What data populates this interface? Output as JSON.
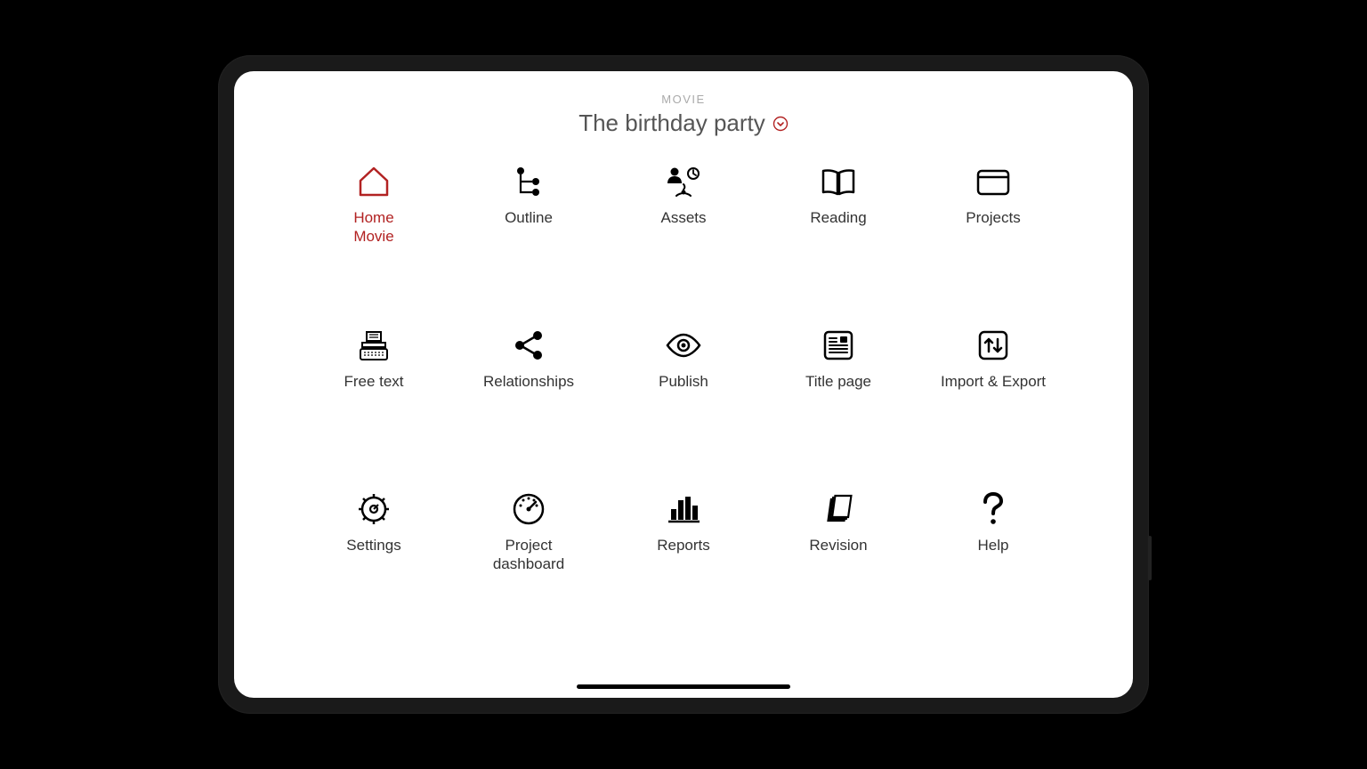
{
  "header": {
    "subtitle": "MOVIE",
    "title": "The birthday party"
  },
  "tiles": {
    "home": {
      "label": "Home",
      "sublabel": "Movie"
    },
    "outline": {
      "label": "Outline"
    },
    "assets": {
      "label": "Assets"
    },
    "reading": {
      "label": "Reading"
    },
    "projects": {
      "label": "Projects"
    },
    "freetext": {
      "label": "Free text"
    },
    "relationships": {
      "label": "Relationships"
    },
    "publish": {
      "label": "Publish"
    },
    "titlepage": {
      "label": "Title page"
    },
    "importexport": {
      "label": "Import & Export"
    },
    "settings": {
      "label": "Settings"
    },
    "dashboard": {
      "label": "Project dashboard"
    },
    "reports": {
      "label": "Reports"
    },
    "revision": {
      "label": "Revision"
    },
    "help": {
      "label": "Help"
    }
  },
  "colors": {
    "accent": "#b22222",
    "text": "#333333",
    "subtitle": "#aaaaaa"
  }
}
